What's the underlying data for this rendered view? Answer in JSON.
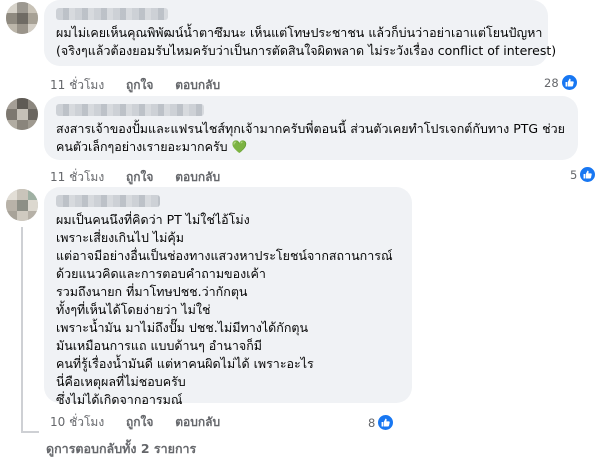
{
  "comments": [
    {
      "lines": [
        "ผมไม่เคยเห็นคุณพิพัฒน์น้ำตาซึมนะ เห็นแต่โทษประชาชน แล้วก็บ่นว่าอย่าเอาแต่โยนปัญหา",
        "(จริงๆแล้วต้องยอมรับไหมครับว่าเป็นการตัดสินใจผิดพลาด ไม่ระวังเรื่อง conflict of interest)"
      ],
      "time": "11 ชั่วโมง",
      "like_label": "ถูกใจ",
      "reply_label": "ตอบกลับ",
      "reaction_count": "28"
    },
    {
      "lines": [
        "สงสารเจ้าของปั้มและแฟรนไชส์ทุกเจ้ามากครับพี่ตอนนี้ ส่วนตัวเคยทำโปรเจกต์กับทาง PTG ช่วย",
        "คนตัวเล็กๆอย่างเรายอะมากครับ 💚"
      ],
      "time": "11 ชั่วโมง",
      "like_label": "ถูกใจ",
      "reply_label": "ตอบกลับ",
      "reaction_count": "5"
    },
    {
      "lines": [
        "ผมเป็นคนนึงที่คิดว่า PT ไม่ใช่ไอ้โม่ง",
        "เพราะเสี่ยงเกินไป ไม่คุ้ม",
        "แต่อาจมีอย่างอื่นเป็นช่องทางแสวงหาประโยชน์จากสถานการณ์",
        "ด้วยแนวคิดและการตอบคำถามของเค้า",
        "รวมถึงนายก ที่มาโทษปชช.ว่ากักตุน",
        "ทั้งๆที่เห็นได้โดยง่ายว่า ไม่ใช่",
        "เพราะน้ำมัน มาไม่ถึงปั๊ม ปชช.ไม่มีทางได้กักตุน",
        "มันเหมือนการแถ แบบด้านๆ อำนาจก็มี",
        "คนที่รู้เรื่องน้ำมันดี แต่หาคนผิดไม่ได้ เพราะอะไร",
        "นี่คือเหตุผลที่ไม่ชอบครับ",
        "ซึ่งไม่ได้เกิดจากอารมณ์"
      ],
      "time": "10 ชั่วโมง",
      "like_label": "ถูกใจ",
      "reply_label": "ตอบกลับ",
      "reaction_count": "8"
    }
  ],
  "more_replies": "ดูการตอบกลับทั้ง 2 รายการ",
  "icons": {
    "like": "like-icon"
  },
  "colors": {
    "bubble": "#f0f2f5",
    "like_blue": "#1877f2",
    "meta_gray": "#65676b"
  }
}
